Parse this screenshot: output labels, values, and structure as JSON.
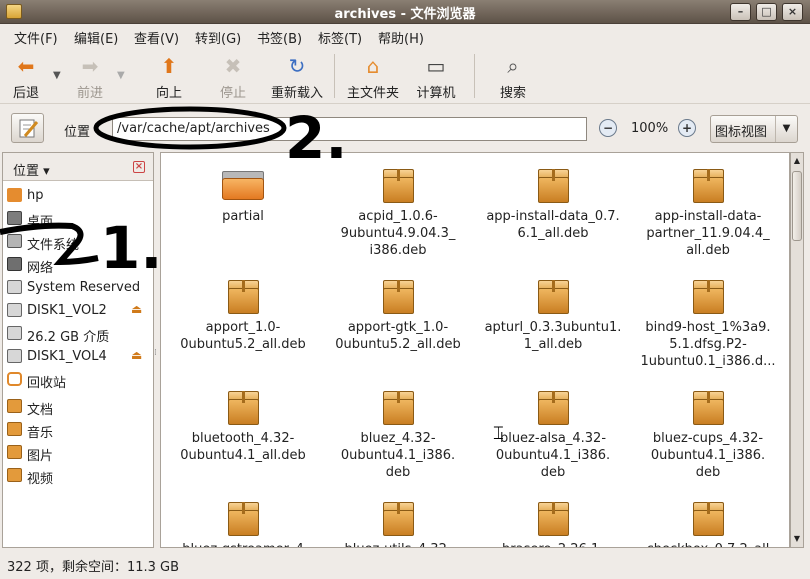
{
  "window": {
    "title": "archives - 文件浏览器",
    "buttons": {
      "minimize": "–",
      "maximize": "□",
      "close": "×"
    }
  },
  "menu": [
    "文件(F)",
    "编辑(E)",
    "查看(V)",
    "转到(G)",
    "书签(B)",
    "标签(T)",
    "帮助(H)"
  ],
  "toolbar": {
    "back": "后退",
    "forward": "前进",
    "up": "向上",
    "stop": "停止",
    "reload": "重新载入",
    "home": "主文件夹",
    "computer": "计算机",
    "search": "搜索"
  },
  "location": {
    "label": "位置",
    "path": "/var/cache/apt/archives",
    "zoom": "100%",
    "view": "图标视图"
  },
  "sidebar": {
    "header": "位置",
    "places": [
      {
        "label": "hp",
        "icon": "home-icon"
      },
      {
        "label": "桌面",
        "icon": "desktop-icon"
      },
      {
        "label": "文件系统",
        "icon": "filesystem-icon"
      },
      {
        "label": "网络",
        "icon": "network-icon"
      },
      {
        "label": "System Reserved",
        "icon": "drive-icon"
      },
      {
        "label": "DISK1_VOL2",
        "icon": "drive-icon",
        "eject": true
      },
      {
        "label": "26.2 GB 介质",
        "icon": "drive-icon"
      },
      {
        "label": "DISK1_VOL4",
        "icon": "drive-icon",
        "eject": true
      },
      {
        "label": "回收站",
        "icon": "trash-icon"
      }
    ],
    "bookmarks": [
      {
        "label": "文档",
        "icon": "folder-icon"
      },
      {
        "label": "音乐",
        "icon": "folder-icon"
      },
      {
        "label": "图片",
        "icon": "folder-icon"
      },
      {
        "label": "视频",
        "icon": "folder-icon"
      }
    ]
  },
  "files": [
    {
      "name": "partial",
      "lines": [
        "partial"
      ],
      "type": "folder"
    },
    {
      "name": "acpid_1.0.6-9ubuntu4.9.04.3_i386.deb",
      "lines": [
        "acpid_1.0.6-",
        "9ubuntu4.9.04.3_",
        "i386.deb"
      ],
      "type": "deb"
    },
    {
      "name": "app-install-data_0.7.6.1_all.deb",
      "lines": [
        "app-install-data_0.7.",
        "6.1_all.deb"
      ],
      "type": "deb"
    },
    {
      "name": "app-install-data-partner_11.9.04.4_all.deb",
      "lines": [
        "app-install-data-",
        "partner_11.9.04.4_",
        "all.deb"
      ],
      "type": "deb"
    },
    {
      "name": "apport_1.0-0ubuntu5.2_all.deb",
      "lines": [
        "apport_1.0-",
        "0ubuntu5.2_all.deb"
      ],
      "type": "deb"
    },
    {
      "name": "apport-gtk_1.0-0ubuntu5.2_all.deb",
      "lines": [
        "apport-gtk_1.0-",
        "0ubuntu5.2_all.deb"
      ],
      "type": "deb"
    },
    {
      "name": "apturl_0.3.3ubuntu1.1_all.deb",
      "lines": [
        "apturl_0.3.3ubuntu1.",
        "1_all.deb"
      ],
      "type": "deb"
    },
    {
      "name": "bind9-host",
      "lines": [
        "bind9-host_1%3a9.",
        "5.1.dfsg.P2-",
        "1ubuntu0.1_i386.d..."
      ],
      "type": "deb"
    },
    {
      "name": "bluetooth_4.32-0ubuntu4.1_all.deb",
      "lines": [
        "bluetooth_4.32-",
        "0ubuntu4.1_all.deb"
      ],
      "type": "deb"
    },
    {
      "name": "bluez_4.32-0ubuntu4.1_i386.deb",
      "lines": [
        "bluez_4.32-",
        "0ubuntu4.1_i386.",
        "deb"
      ],
      "type": "deb"
    },
    {
      "name": "bluez-alsa_4.32-0ubuntu4.1_i386.deb",
      "lines": [
        "bluez-alsa_4.32-",
        "0ubuntu4.1_i386.",
        "deb"
      ],
      "type": "deb"
    },
    {
      "name": "bluez-cups_4.32-0ubuntu4.1_i386.deb",
      "lines": [
        "bluez-cups_4.32-",
        "0ubuntu4.1_i386.",
        "deb"
      ],
      "type": "deb"
    },
    {
      "name": "bluez-gstreamer_4",
      "lines": [
        "bluez-gstreamer_4"
      ],
      "type": "deb"
    },
    {
      "name": "bluez-utils_4.32-",
      "lines": [
        "bluez-utils_4.32-"
      ],
      "type": "deb"
    },
    {
      "name": "brasero_2.26.1-",
      "lines": [
        "brasero_2.26.1-"
      ],
      "type": "deb"
    },
    {
      "name": "checkbox_0.7.2_all",
      "lines": [
        "checkbox_0.7.2_all"
      ],
      "type": "deb"
    }
  ],
  "status": "322 项，剩余空间：11.3 GB",
  "annotations": [
    "1.",
    "2."
  ]
}
